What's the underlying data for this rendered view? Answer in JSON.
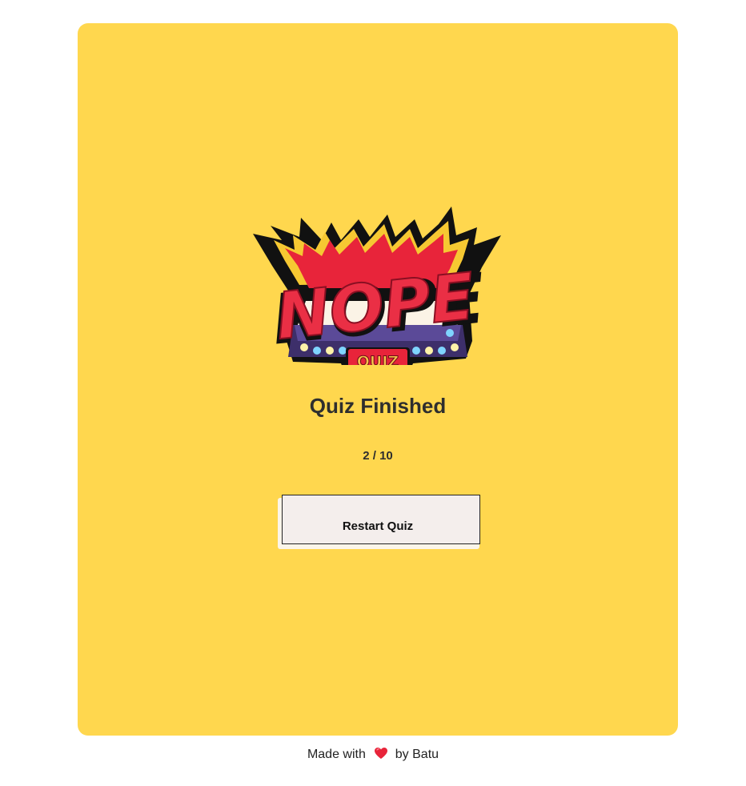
{
  "logo": {
    "main_text": "NOPE",
    "badge_text": "QUIZ"
  },
  "result": {
    "title": "Quiz Finished",
    "score": "2 / 10"
  },
  "actions": {
    "restart_label": "Restart Quiz"
  },
  "footer": {
    "prefix": "Made with",
    "heart_icon": "heart-icon",
    "suffix": "by Batu"
  },
  "colors": {
    "card_background": "#ffd74e",
    "button_background": "#f4eeec",
    "heart": "#e8243a",
    "logo_red": "#e8243a",
    "logo_gold": "#f6c14a"
  }
}
